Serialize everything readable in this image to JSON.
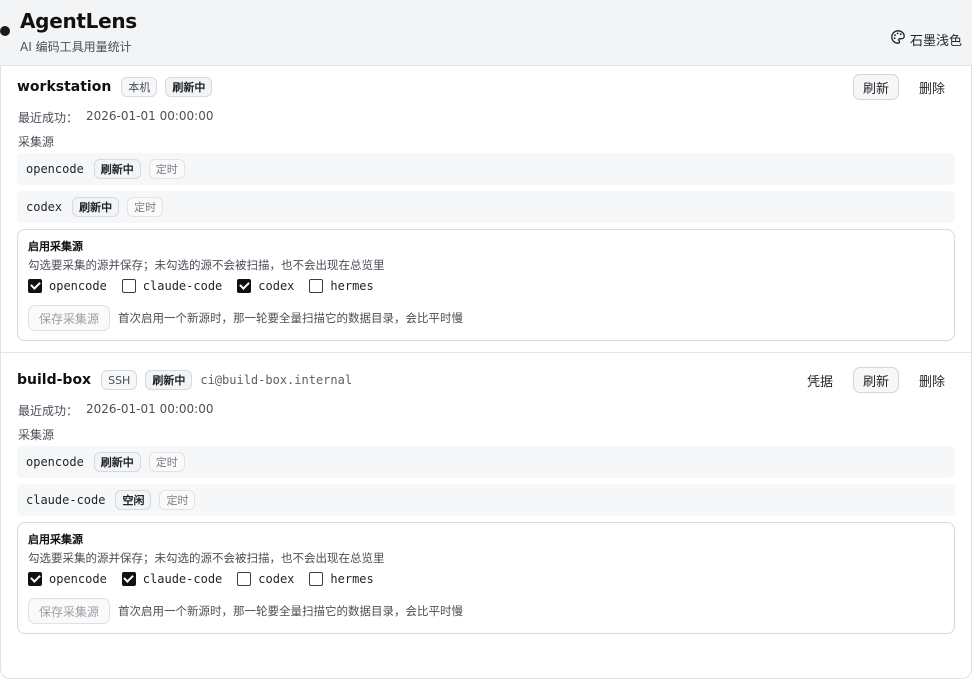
{
  "app": {
    "title": "AgentLens",
    "subtitle": "AI 编码工具用量统计",
    "theme_label": "石墨浅色"
  },
  "labels": {
    "last_success": "最近成功：",
    "sources_title": "采集源",
    "enable_title": "启用采集源",
    "enable_desc": "勾选要采集的源并保存；未勾选的源不会被扫描，也不会出现在总览里",
    "save_button": "保存采集源",
    "save_hint": "首次启用一个新源时，那一轮要全量扫描它的数据目录，会比平时慢",
    "refresh": "刷新",
    "delete": "删除",
    "credentials": "凭据"
  },
  "machines": [
    {
      "name": "workstation",
      "badges": [
        "本机",
        "刷新中"
      ],
      "host": "",
      "last_success_time": "2026-01-01 00:00:00",
      "sources": [
        {
          "name": "opencode",
          "status": "刷新中",
          "mode": "定时"
        },
        {
          "name": "codex",
          "status": "刷新中",
          "mode": "定时"
        }
      ],
      "checks": [
        {
          "label": "opencode",
          "checked": true
        },
        {
          "label": "claude-code",
          "checked": false
        },
        {
          "label": "codex",
          "checked": true
        },
        {
          "label": "hermes",
          "checked": false
        }
      ]
    },
    {
      "name": "build-box",
      "badges": [
        "SSH",
        "刷新中"
      ],
      "host": "ci@build-box.internal",
      "last_success_time": "2026-01-01 00:00:00",
      "sources": [
        {
          "name": "opencode",
          "status": "刷新中",
          "mode": "定时"
        },
        {
          "name": "claude-code",
          "status": "空闲",
          "mode": "定时"
        }
      ],
      "checks": [
        {
          "label": "opencode",
          "checked": true
        },
        {
          "label": "claude-code",
          "checked": true
        },
        {
          "label": "codex",
          "checked": false
        },
        {
          "label": "hermes",
          "checked": false
        }
      ]
    }
  ],
  "icons": {
    "theme": "palette-icon",
    "status_dot": "dot-icon"
  },
  "colors": {
    "accent": "#111111",
    "header_bg": "#f3f4f6",
    "row_bg": "#f6f7f8"
  }
}
